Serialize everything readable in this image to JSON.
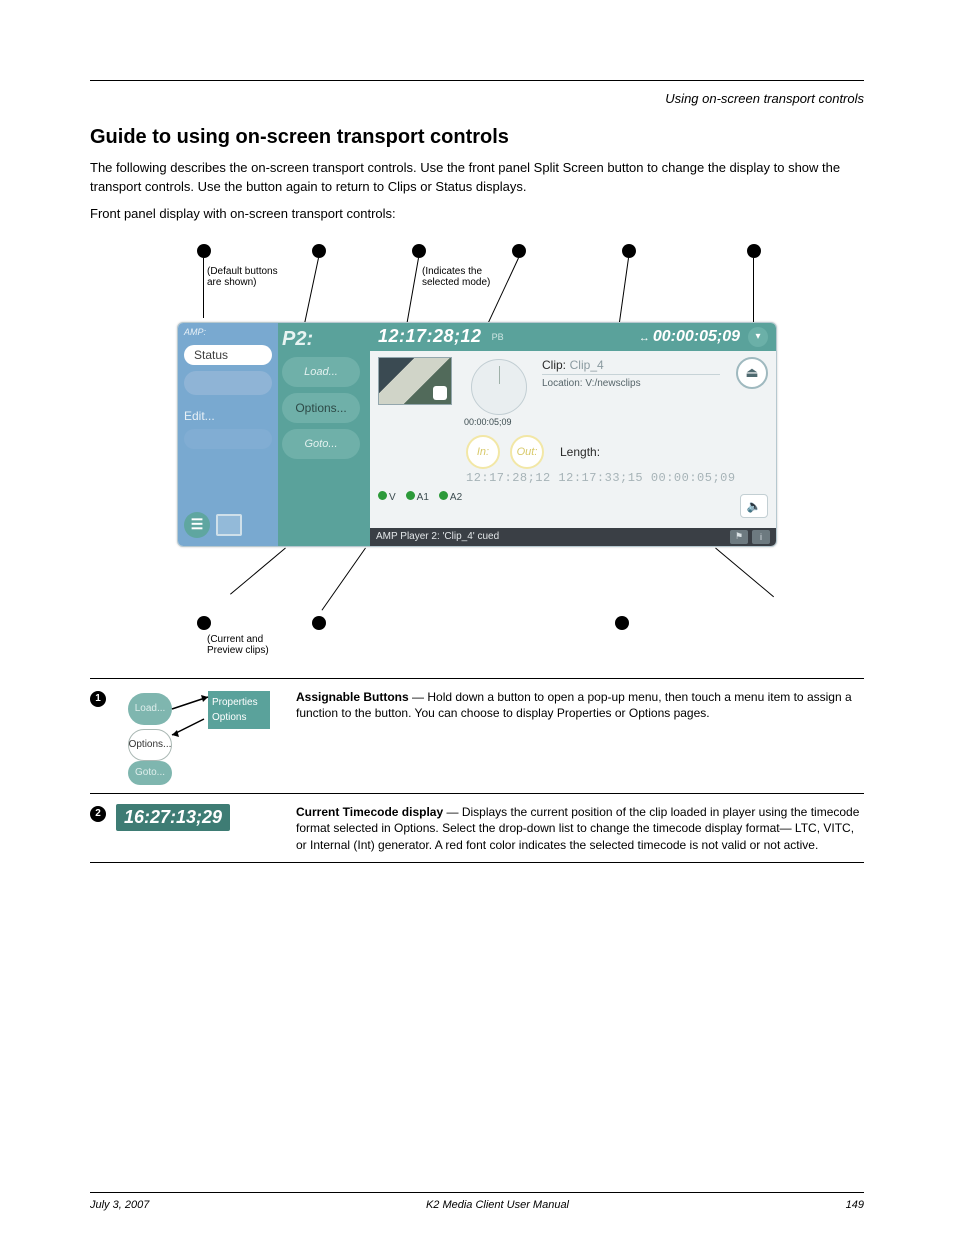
{
  "header": {
    "breadcrumb": "Using on-screen transport controls"
  },
  "section": {
    "title": "Guide to using on-screen transport controls",
    "p1": "The following describes the on-screen transport controls. Use the front panel Split Screen button to change the display to show the transport controls. Use the button again to return to Clips or Status displays.",
    "p2": "Front panel display with on-screen transport controls:"
  },
  "callouts": {
    "defaults": "(Default buttons\nare shown)",
    "mode": "(Indicates the\nselected mode)",
    "preview": "(Current and\nPreview clips)"
  },
  "panel": {
    "amp": "AMP:",
    "status": "Status",
    "edit": "Edit...",
    "p2": "P2:",
    "load": "Load...",
    "options": "Options...",
    "goto": "Goto...",
    "tc_main": "12:17:28;12",
    "tc_pb": "PB",
    "tc_count_sym": "↔",
    "tc_count": "00:00:05;09",
    "clip_lbl": "Clip:",
    "clip_name": "Clip_4",
    "loc_lbl": "Location:",
    "loc_val": "V:/newsclips",
    "in": "In:",
    "out": "Out:",
    "length": "Length:",
    "tc_triple": "12:17:28;12  12:17:33;15  00:00:05;09",
    "knob_time": "00:00:05;09",
    "v": "V",
    "a1": "A1",
    "a2": "A2",
    "status_text": "AMP Player 2: 'Clip_4' cued"
  },
  "legend": {
    "row1_bold": "Assignable Buttons",
    "row1_text": " — Hold down a button to open a pop-up menu, then touch a menu item to assign a function to the button. You can choose to display Properties or Options pages.",
    "row1_load": "Load...",
    "row1_options_btn": "Options...",
    "row1_goto": "Goto...",
    "row1_menu_prop": "Properties",
    "row1_menu_opt": "Options",
    "row2_bold": "Current Timecode display",
    "row2_text": " — Displays the current position of the clip loaded in player using the timecode format selected in Options. Select the drop-down list to change the timecode display format— LTC, VITC, or Internal (Int) generator. A red font color indicates the selected timecode is not valid or not active.",
    "row2_tc": "16:27:13;29"
  },
  "footer": {
    "date": "July 3, 2007",
    "manual": "K2 Media Client User Manual",
    "page": "149"
  }
}
